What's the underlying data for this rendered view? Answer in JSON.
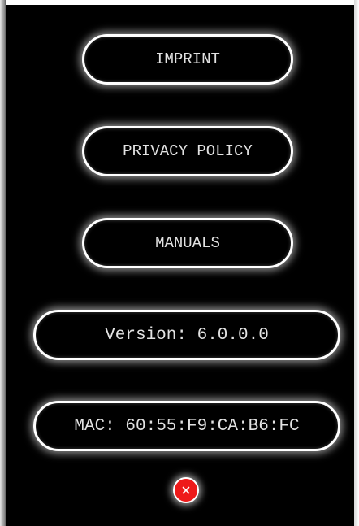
{
  "menu": {
    "imprint_label": "IMPRINT",
    "privacy_label": "PRIVACY POLICY",
    "manuals_label": "MANUALS"
  },
  "info": {
    "version_text": "Version: 6.0.0.0",
    "mac_text": "MAC: 60:55:F9:CA:B6:FC"
  },
  "close": {
    "icon": "close-icon",
    "color": "#ee1a1a"
  },
  "theme": {
    "background": "#000000",
    "border": "#ffffff",
    "text": "#e2e2e2"
  }
}
